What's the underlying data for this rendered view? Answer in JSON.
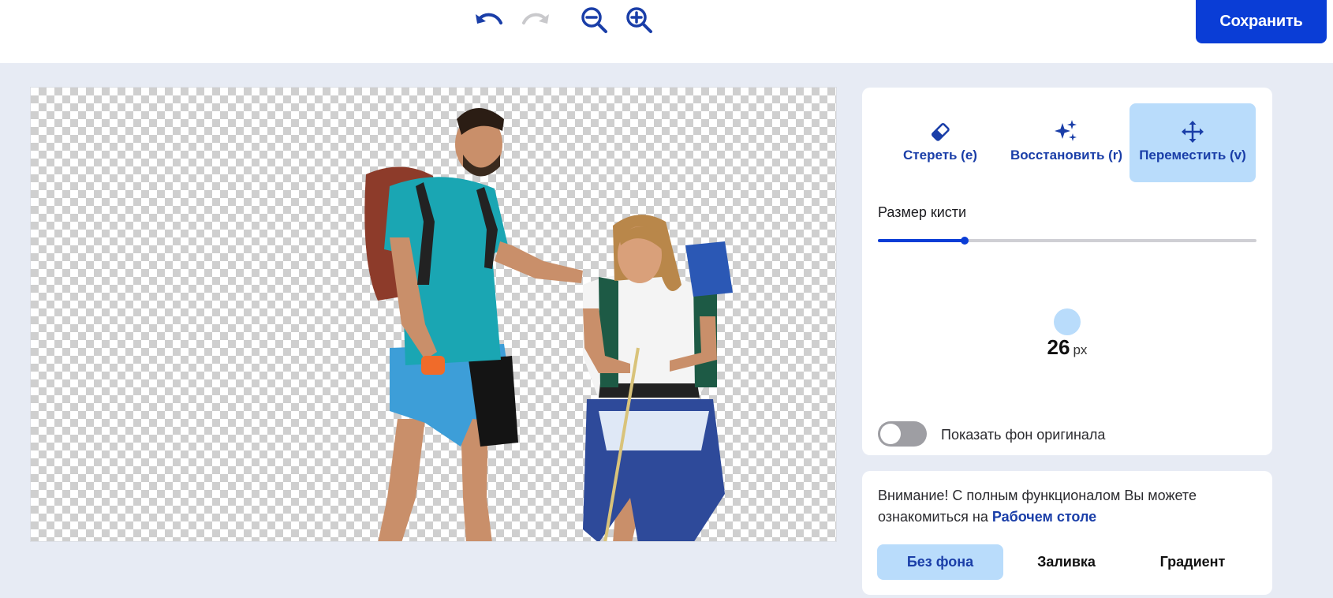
{
  "toolbar": {
    "undo_icon": "undo-icon",
    "redo_icon": "redo-icon",
    "zoom_out_icon": "zoom-out-icon",
    "zoom_in_icon": "zoom-in-icon",
    "save_label": "Сохранить"
  },
  "modes": [
    {
      "label": "Стереть (e)",
      "icon": "eraser-icon",
      "active": false
    },
    {
      "label": "Восстановить (r)",
      "icon": "sparkles-icon",
      "active": false
    },
    {
      "label": "Переместить (v)",
      "icon": "move-icon",
      "active": true
    }
  ],
  "brush": {
    "label": "Размер кисти",
    "value_fraction": 0.23,
    "size_value": "26",
    "size_unit": "px"
  },
  "show_original": {
    "label": "Показать фон оригинала",
    "enabled": false
  },
  "notice": {
    "text": "Внимание! С полным функционалом Вы можете ознакомиться на ",
    "link": "Рабочем столе"
  },
  "background_tabs": [
    {
      "label": "Без фона",
      "active": true
    },
    {
      "label": "Заливка",
      "active": false
    },
    {
      "label": "Градиент",
      "active": false
    }
  ],
  "colors": {
    "accent": "#0a3dd6",
    "accent_light": "#b9dcfb",
    "link": "#1a3ea8",
    "page_bg": "#e7ebf4"
  }
}
